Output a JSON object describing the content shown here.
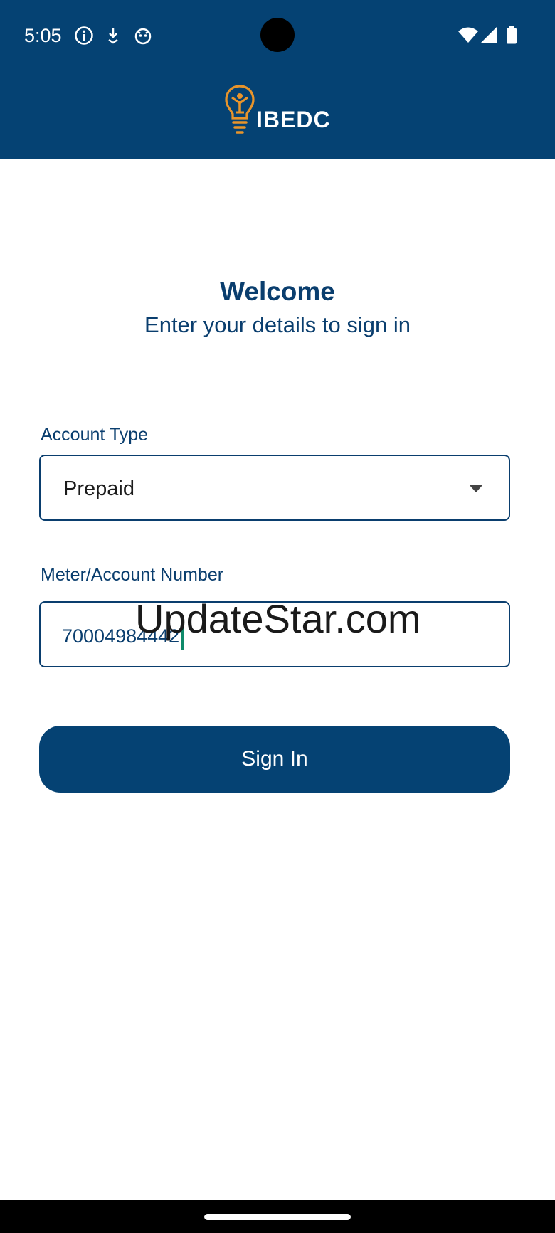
{
  "status_bar": {
    "time": "5:05",
    "left_icons": [
      "info-icon",
      "download-icon",
      "bug-icon"
    ],
    "right_icons": [
      "wifi-icon",
      "signal-icon",
      "battery-icon"
    ]
  },
  "header": {
    "logo_text": "IBEDC",
    "logo_icon": "lightbulb-person-icon",
    "background_color": "#054273",
    "accent_color": "#E8942B"
  },
  "main": {
    "title": "Welcome",
    "subtitle": "Enter your details to sign in"
  },
  "form": {
    "account_type_label": "Account Type",
    "account_type_value": "Prepaid",
    "meter_label": "Meter/Account Number",
    "meter_value": "70004984442",
    "submit_label": "Sign In"
  },
  "watermark": {
    "text": "UpdateStar.com"
  }
}
